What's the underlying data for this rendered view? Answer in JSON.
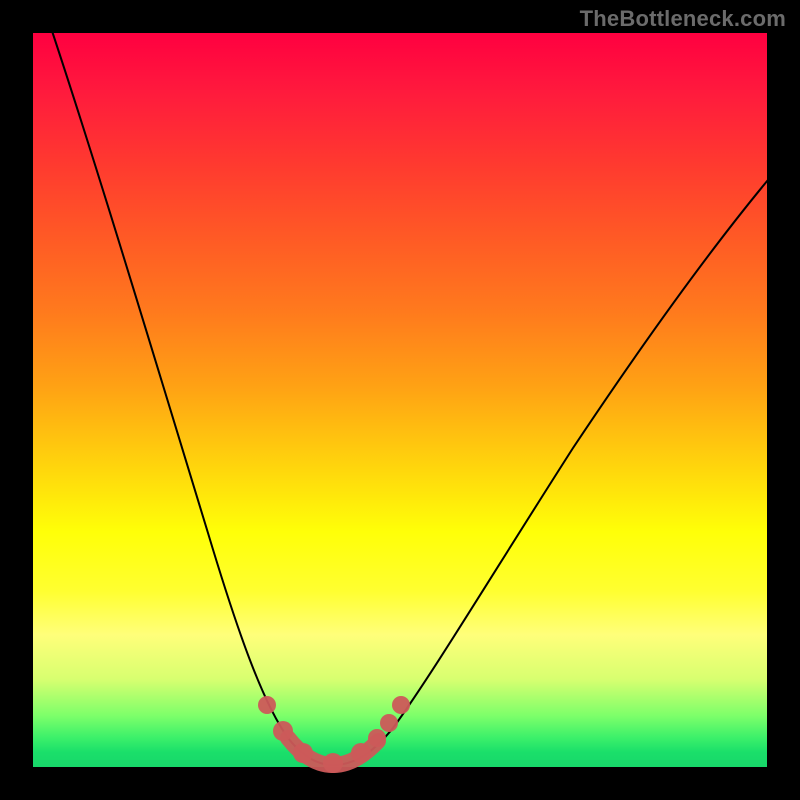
{
  "watermark": "TheBottleneck.com",
  "colors": {
    "background": "#000000",
    "gradient_top": "#ff0040",
    "gradient_bottom": "#18d76a",
    "curve": "#000000",
    "markers": "#cc5a5a"
  },
  "chart_data": {
    "type": "line",
    "title": "",
    "xlabel": "",
    "ylabel": "",
    "xlim": [
      0,
      100
    ],
    "ylim": [
      0,
      100
    ],
    "x": [
      0,
      5,
      10,
      15,
      20,
      25,
      28,
      30,
      32,
      34,
      36,
      38,
      40,
      45,
      50,
      55,
      60,
      65,
      70,
      75,
      80,
      85,
      90,
      95,
      100
    ],
    "values": [
      100,
      82,
      64,
      47,
      32,
      18,
      11,
      7,
      4,
      2,
      1,
      0,
      0,
      2,
      6,
      12,
      19,
      26,
      34,
      42,
      50,
      58,
      66,
      73,
      81
    ],
    "markers_x": [
      28,
      30,
      32,
      34,
      36,
      38,
      40,
      42,
      44,
      46
    ],
    "markers_y": [
      11,
      7,
      4,
      2,
      1,
      0,
      0,
      1,
      2,
      4
    ],
    "note": "Curve shape estimated from pixels; no axis ticks are shown."
  }
}
